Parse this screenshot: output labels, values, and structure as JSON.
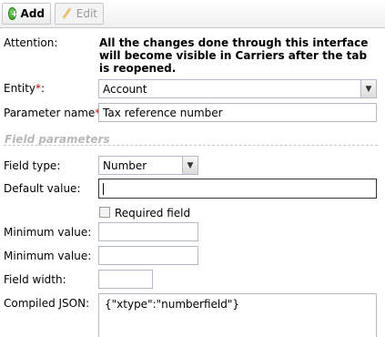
{
  "toolbar": {
    "add_label": "Add",
    "edit_label": "Edit"
  },
  "form": {
    "attention_label": "Attention:",
    "attention_text": "All the changes done through this interface will become visible in Carriers after the tab is reopened.",
    "entity_label": "Entity",
    "entity_value": "Account",
    "param_name_label": "Parameter name",
    "param_name_value": "Tax reference number",
    "required_marker": "*",
    "label_suffix": ":"
  },
  "field_parameters": {
    "section_title": "Field parameters",
    "field_type_label": "Field type:",
    "field_type_value": "Number",
    "default_value_label": "Default value:",
    "default_value": "",
    "required_field_label": "Required field",
    "required_field_checked": false,
    "min_value_label_1": "Minimum value:",
    "min_value_1": "",
    "min_value_label_2": "Minimum value:",
    "min_value_2": "",
    "field_width_label": "Field width:",
    "field_width": "",
    "compiled_json_label": "Compiled JSON:",
    "compiled_json_value": "{\"xtype\":\"numberfield\"}"
  },
  "colors": {
    "required_marker": "#cc0000",
    "section_title": "#b8b8b8",
    "input_border": "#b5b8c8"
  }
}
